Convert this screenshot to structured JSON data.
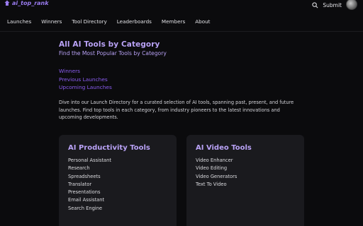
{
  "brand": {
    "name": "ai_top_rank",
    "accent": "#9a7bf0"
  },
  "header": {
    "submit_label": "Submit",
    "icons": [
      "search-icon",
      "avatar"
    ]
  },
  "nav": {
    "items": [
      "Launches",
      "Winners",
      "Tool Directory",
      "Leaderboards",
      "Members",
      "About"
    ]
  },
  "main": {
    "title": "All AI Tools by Category",
    "subtitle": "Find the Most Popular Tools by Category",
    "links": [
      "Winners",
      "Previous Launches",
      "Upcoming Launches"
    ],
    "description": "Dive into our Launch Directory for a curated selection of AI tools, spanning past, present, and future launches. Find top tools in each category, from industry pioneers to the latest innovations and upcoming developments."
  },
  "categories": [
    {
      "title": "AI Productivity Tools",
      "items": [
        "Personal Assistant",
        "Research",
        "Spreadsheets",
        "Translator",
        "Presentations",
        "Email Assistant",
        "Search Engine"
      ]
    },
    {
      "title": "AI Video Tools",
      "items": [
        "Video Enhancer",
        "Video Editing",
        "Video Generators",
        "Text To Video"
      ]
    }
  ],
  "colors": {
    "background": "#0b0b0d",
    "card": "#1a1a1e",
    "heading": "#b9a2f6",
    "link": "#8a5cf0"
  }
}
